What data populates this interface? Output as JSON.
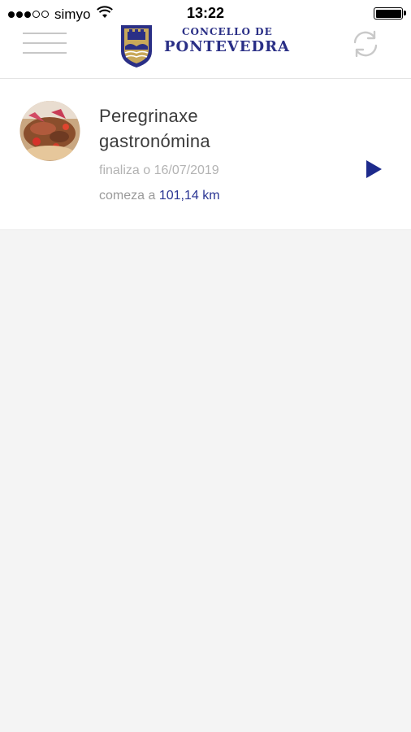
{
  "status_bar": {
    "carrier": "simyo",
    "time": "13:22",
    "signal_bars_filled": 3,
    "signal_bars_total": 5
  },
  "header": {
    "logo_line1": "CONCELLO DE",
    "logo_line2": "PONTEVEDRA",
    "brand_color": "#2a2f86",
    "menu_icon": "hamburger-menu-icon",
    "refresh_icon": "refresh-icon"
  },
  "route": {
    "title_line1": "Peregrinaxe",
    "title_line2": "gastronómina",
    "end_date": "finaliza o 16/07/2019",
    "start_prefix": "comeza a",
    "start_distance": "101,14 km",
    "play_icon": "play-icon",
    "accent_color": "#1d2a8c"
  }
}
